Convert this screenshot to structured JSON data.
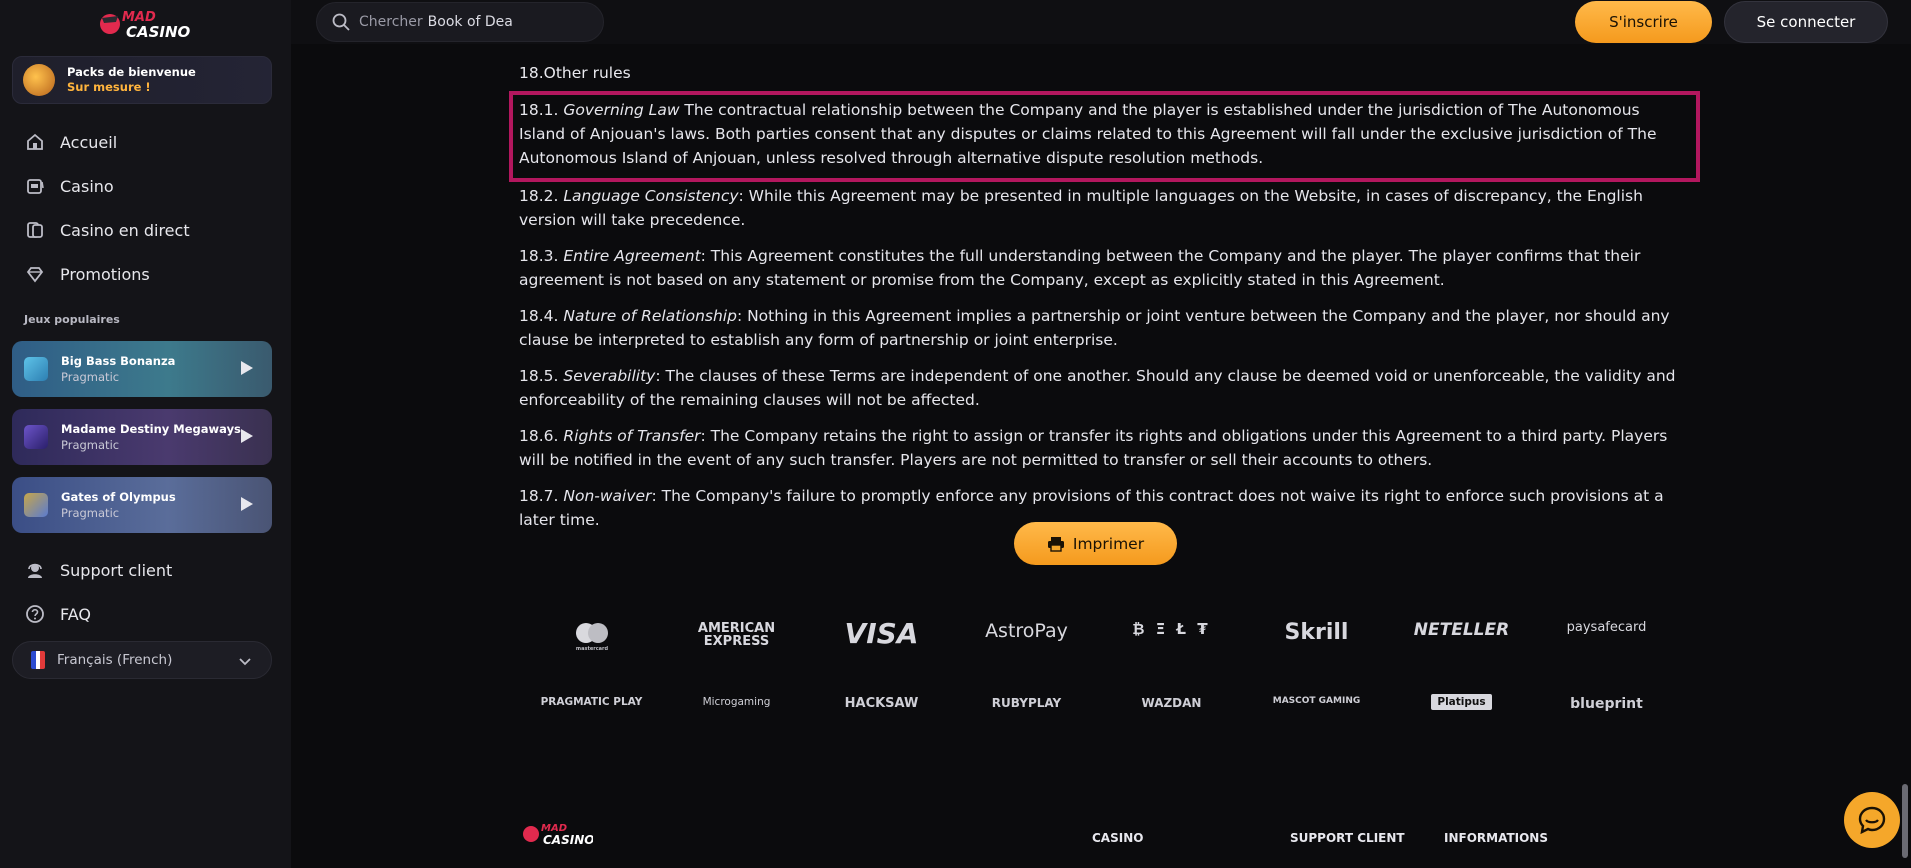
{
  "brand": {
    "logo_text_1": "MAD",
    "logo_text_2": "CASINO"
  },
  "sidebar": {
    "welcome": {
      "title": "Packs de bienvenue",
      "subtitle": "Sur mesure !"
    },
    "nav": [
      {
        "label": "Accueil",
        "icon": "home-icon"
      },
      {
        "label": "Casino",
        "icon": "slot-machine-icon"
      },
      {
        "label": "Casino en direct",
        "icon": "cards-icon"
      },
      {
        "label": "Promotions",
        "icon": "diamond-icon"
      }
    ],
    "popular_label": "Jeux populaires",
    "games": [
      {
        "title": "Big Bass Bonanza",
        "provider": "Pragmatic"
      },
      {
        "title": "Madame Destiny Megaways",
        "provider": "Pragmatic"
      },
      {
        "title": "Gates of Olympus",
        "provider": "Pragmatic"
      }
    ],
    "support": "Support client",
    "faq": "FAQ",
    "language": "Français (French)"
  },
  "header": {
    "search_placeholder": "Chercher",
    "search_value": "Book of Dea",
    "signup": "S'inscrire",
    "login": "Se connecter"
  },
  "terms": {
    "heading": "18.Other rules",
    "items": [
      {
        "num": "18.1.",
        "title": "Governing Law",
        "text": " The contractual relationship between the Company and the player is established under the jurisdiction of The Autonomous Island of Anjouan's laws. Both parties consent that any disputes or claims related to this Agreement will fall under the exclusive jurisdiction of The Autonomous Island of Anjouan, unless resolved through alternative dispute resolution methods."
      },
      {
        "num": "18.2.",
        "title": "Language Consistency",
        "text": ": While this Agreement may be presented in multiple languages on the Website, in cases of discrepancy, the English version will take precedence."
      },
      {
        "num": "18.3.",
        "title": "Entire Agreement",
        "text": ": This Agreement constitutes the full understanding between the Company and the player. The player confirms that their agreement is not based on any statement or promise from the Company, except as explicitly stated in this Agreement."
      },
      {
        "num": "18.4.",
        "title": "Nature of Relationship",
        "text": ": Nothing in this Agreement implies a partnership or joint venture between the Company and the player, nor should any clause be interpreted to establish any form of partnership or joint enterprise."
      },
      {
        "num": "18.5.",
        "title": "Severability",
        "text": ": The clauses of these Terms are independent of one another. Should any clause be deemed void or unenforceable, the validity and enforceability of the remaining clauses will not be affected."
      },
      {
        "num": "18.6.",
        "title": "Rights of Transfer",
        "text": ": The Company retains the right to assign or transfer its rights and obligations under this Agreement to a third party. Players will be notified in the event of any such transfer. Players are not permitted to transfer or sell their accounts to others."
      },
      {
        "num": "18.7.",
        "title": "Non-waiver",
        "text": ": The Company's failure to promptly enforce any provisions of this contract does not waive its right to enforce such provisions at a later time."
      }
    ],
    "print_button": "Imprimer"
  },
  "payment_logos": [
    "mastercard",
    "AMERICAN EXPRESS",
    "VISA",
    "AstroPay",
    "₿ Ξ Ł ₮",
    "Skrill",
    "NETELLER",
    "paysafecard"
  ],
  "provider_logos": [
    "PRAGMATIC PLAY",
    "Microgaming",
    "HACKSAW",
    "RUBYPLAY",
    "WAZDAN",
    "MASCOT GAMING",
    "Platipus",
    "blueprint"
  ],
  "footer": {
    "columns": [
      "CASINO",
      "SUPPORT CLIENT",
      "INFORMATIONS"
    ]
  },
  "colors": {
    "accent": "#f5a72a",
    "highlight_border": "#b3175e"
  }
}
